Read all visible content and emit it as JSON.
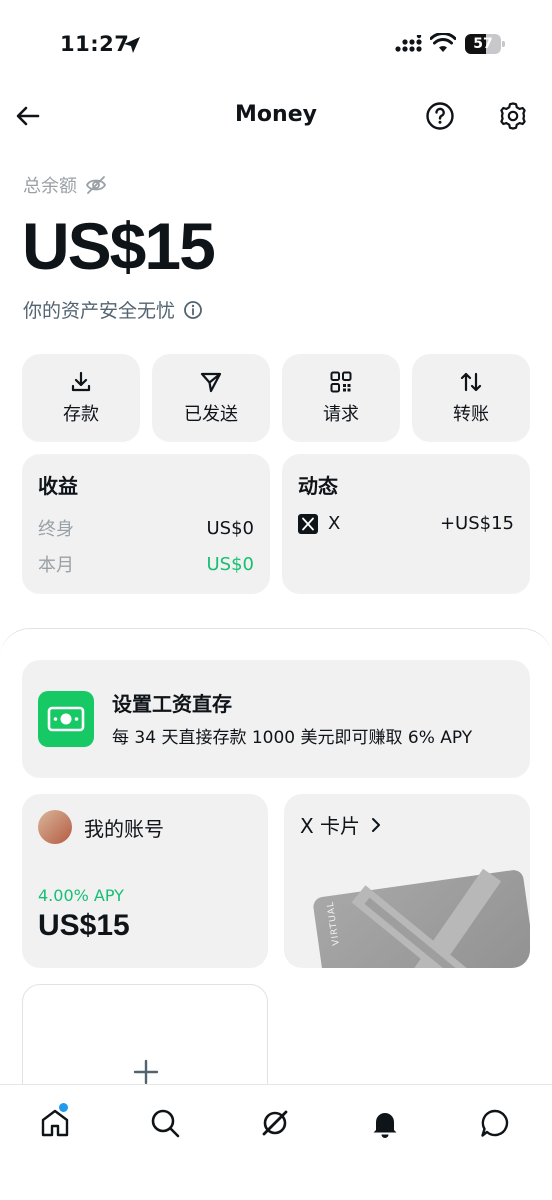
{
  "status_bar": {
    "time": "11:27",
    "battery": "57",
    "battery_level": 0.57
  },
  "header": {
    "title": "Money"
  },
  "balance": {
    "label": "总余额",
    "amount": "US$15",
    "safety_text": "你的资产安全无忧"
  },
  "actions": [
    {
      "label": "存款",
      "icon": "download-icon"
    },
    {
      "label": "已发送",
      "icon": "send-icon"
    },
    {
      "label": "请求",
      "icon": "qr-code-icon"
    },
    {
      "label": "转账",
      "icon": "transfer-icon"
    }
  ],
  "earnings": {
    "title": "收益",
    "lifetime_label": "终身",
    "lifetime_value": "US$0",
    "month_label": "本月",
    "month_value": "US$0",
    "accent": "#17bf73"
  },
  "activity": {
    "title": "动态",
    "item_name": "X",
    "item_amount": "+US$15"
  },
  "payroll": {
    "title": "设置工资直存",
    "description": "每 34 天直接存款 1000 美元即可赚取 6% APY",
    "icon_color": "#17c964"
  },
  "account": {
    "title": "我的账号",
    "apy": "4.00% APY",
    "balance": "US$15"
  },
  "x_card": {
    "title": "X 卡片",
    "card_text": "VIRTUAL"
  },
  "add_account": {
    "icon": "plus-icon"
  },
  "tabs": [
    "home-icon",
    "search-icon",
    "grok-icon",
    "notifications-icon",
    "messages-icon"
  ]
}
